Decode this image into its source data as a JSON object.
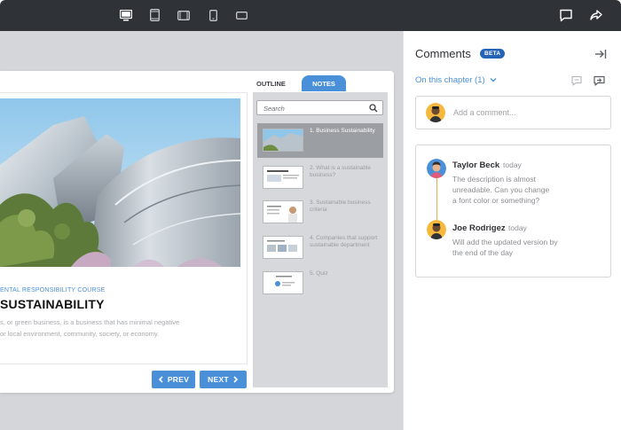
{
  "toolbar": {
    "devices": [
      "desktop-icon",
      "tablet-portrait-icon",
      "tablet-landscape-icon",
      "phone-icon",
      "phone-landscape-icon"
    ],
    "actions": [
      "comment-icon",
      "share-icon"
    ],
    "colors": {
      "background": "#2f3237",
      "icon": "#c7c9cd",
      "active_icon": "#ffffff"
    }
  },
  "slide": {
    "course_label": "ENTAL RESPONSIBILITY COURSE",
    "title": "SUSTAINABILITY",
    "paragraph_lines": [
      "s, or green business, is a business that has minimal negative",
      "or local environment, community, society, or economy."
    ]
  },
  "navigation": {
    "prev_label": "PREV",
    "next_label": "NEXT",
    "accent": "#4a90d9"
  },
  "outline": {
    "tabs": {
      "outline": "OUTLINE",
      "notes": "NOTES"
    },
    "search_placeholder": "Search",
    "items": [
      {
        "label": "1. Business Sustainability",
        "active": true
      },
      {
        "label": "2. What is a sustainable business?",
        "active": false
      },
      {
        "label": "3. Sustainable business criteria",
        "active": false
      },
      {
        "label": "4. Companies that support sustainable department",
        "active": false
      },
      {
        "label": "5. Quiz",
        "active": false
      }
    ]
  },
  "comments": {
    "title": "Comments",
    "badge": "BETA",
    "chapter_filter": "On this chapter (1)",
    "add_placeholder": "Add a comment...",
    "thread": [
      {
        "author": "Taylor Beck",
        "time": "today",
        "lines": [
          "The description is almost",
          "unreadable. Can you change",
          "a font color or something?"
        ]
      },
      {
        "author": "Joe Rodrigez",
        "time": "today",
        "lines": [
          "Will add the updated version by",
          "the end of the day"
        ]
      }
    ]
  }
}
